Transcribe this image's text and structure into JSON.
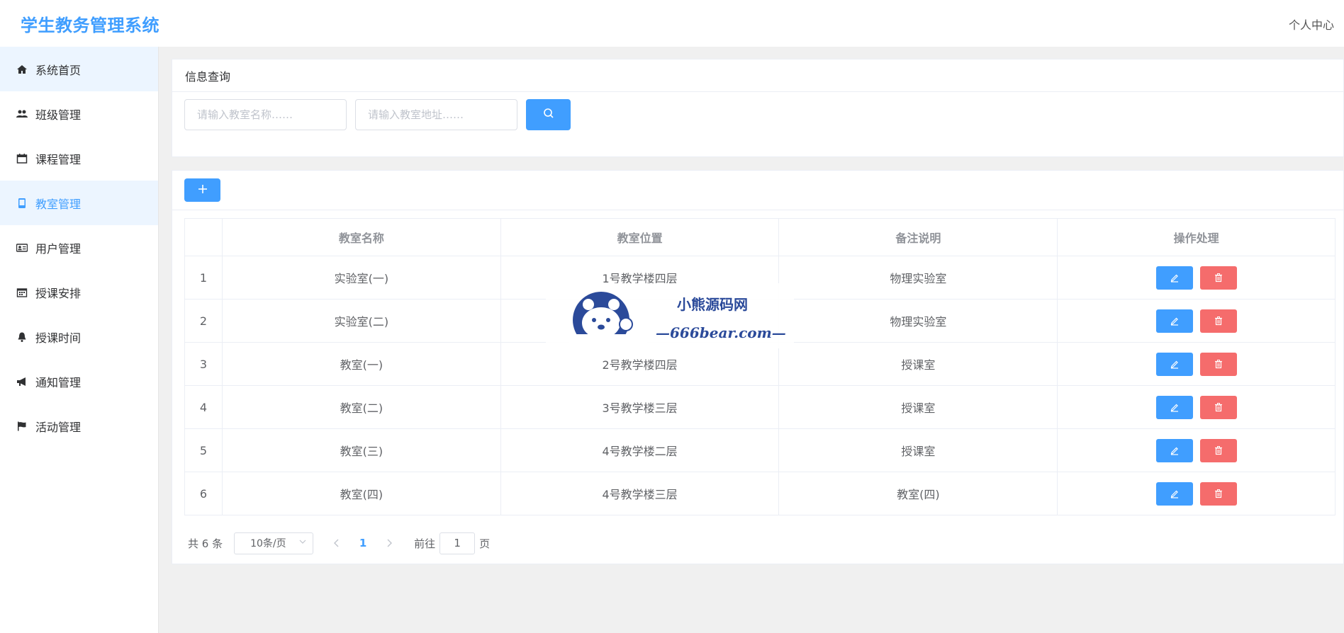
{
  "header": {
    "brand": "学生教务管理系统",
    "user_center": "个人中心"
  },
  "sidebar": {
    "items": [
      {
        "label": "系统首页",
        "icon": "home-icon"
      },
      {
        "label": "班级管理",
        "icon": "users-icon"
      },
      {
        "label": "课程管理",
        "icon": "calendar-icon"
      },
      {
        "label": "教室管理",
        "icon": "mobile-icon"
      },
      {
        "label": "用户管理",
        "icon": "id-card-icon"
      },
      {
        "label": "授课安排",
        "icon": "calendar-grid-icon"
      },
      {
        "label": "授课时间",
        "icon": "bell-icon"
      },
      {
        "label": "通知管理",
        "icon": "bullhorn-icon"
      },
      {
        "label": "活动管理",
        "icon": "flag-icon"
      }
    ]
  },
  "search": {
    "title": "信息查询",
    "name_placeholder": "请输入教室名称……",
    "address_placeholder": "请输入教室地址……"
  },
  "table": {
    "headers": [
      "",
      "教室名称",
      "教室位置",
      "备注说明",
      "操作处理"
    ],
    "rows": [
      {
        "index": "1",
        "name": "实验室(一)",
        "location": "1号教学楼四层",
        "note": "物理实验室"
      },
      {
        "index": "2",
        "name": "实验室(二)",
        "location": "",
        "note": "物理实验室"
      },
      {
        "index": "3",
        "name": "教室(一)",
        "location": "2号教学楼四层",
        "note": "授课室"
      },
      {
        "index": "4",
        "name": "教室(二)",
        "location": "3号教学楼三层",
        "note": "授课室"
      },
      {
        "index": "5",
        "name": "教室(三)",
        "location": "4号教学楼二层",
        "note": "授课室"
      },
      {
        "index": "6",
        "name": "教室(四)",
        "location": "4号教学楼三层",
        "note": "教室(四)"
      }
    ]
  },
  "pagination": {
    "total": "共 6 条",
    "page_size": "10条/页",
    "current": "1",
    "goto_prefix": "前往",
    "goto_value": "1",
    "goto_suffix": "页"
  },
  "watermark": {
    "line1": "小熊源码网",
    "line2": "—666bear.com—"
  },
  "colors": {
    "primary": "#409eff",
    "danger": "#f56c6c"
  }
}
